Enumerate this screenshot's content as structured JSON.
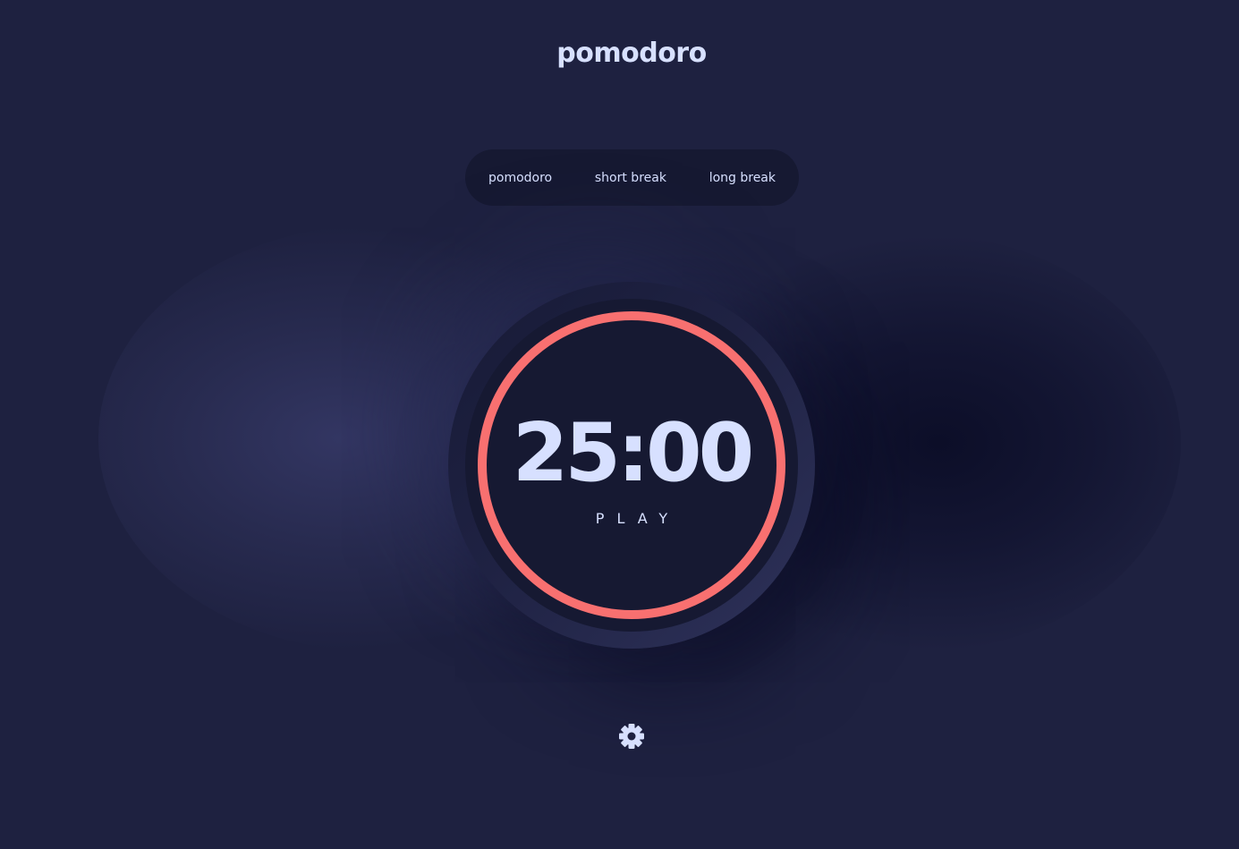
{
  "app": {
    "title": "pomodoro"
  },
  "modes": {
    "tabs": [
      {
        "label": "pomodoro"
      },
      {
        "label": "short break"
      },
      {
        "label": "long break"
      }
    ]
  },
  "timer": {
    "time": "25:00",
    "action": "PLAY",
    "progress": 1.0
  },
  "settings": {
    "icon": "gear-icon"
  },
  "colors": {
    "background": "#1e2140",
    "panel": "#161932",
    "accent": "#f87070",
    "text": "#d7e0ff"
  }
}
